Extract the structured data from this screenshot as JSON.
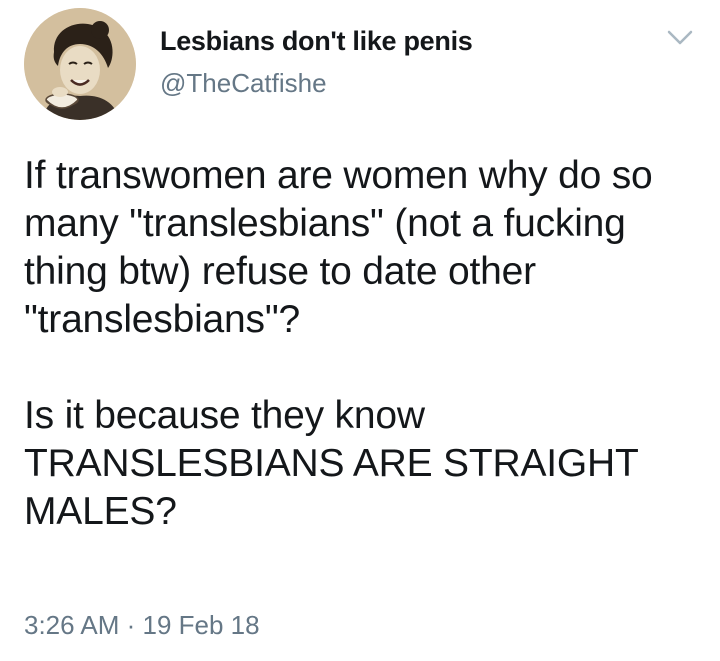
{
  "user": {
    "display_name": "Lesbians don't like penis",
    "handle": "@TheCatfishe",
    "avatar_icon": "vintage-woman-avatar-icon"
  },
  "tweet": {
    "paragraph_1": "If transwomen are women why do so many \"translesbians\" (not a fucking thing btw) refuse to date other \"translesbians\"?",
    "paragraph_2": "Is it because they know TRANSLESBIANS ARE STRAIGHT MALES?",
    "timestamp": "3:26 AM · 19 Feb 18"
  },
  "menu": {
    "icon": "chevron-down-icon"
  },
  "colors": {
    "text_primary": "#14171a",
    "text_secondary": "#657786",
    "chevron": "#aab8c2",
    "avatar_bg": "#d8c6a8"
  }
}
